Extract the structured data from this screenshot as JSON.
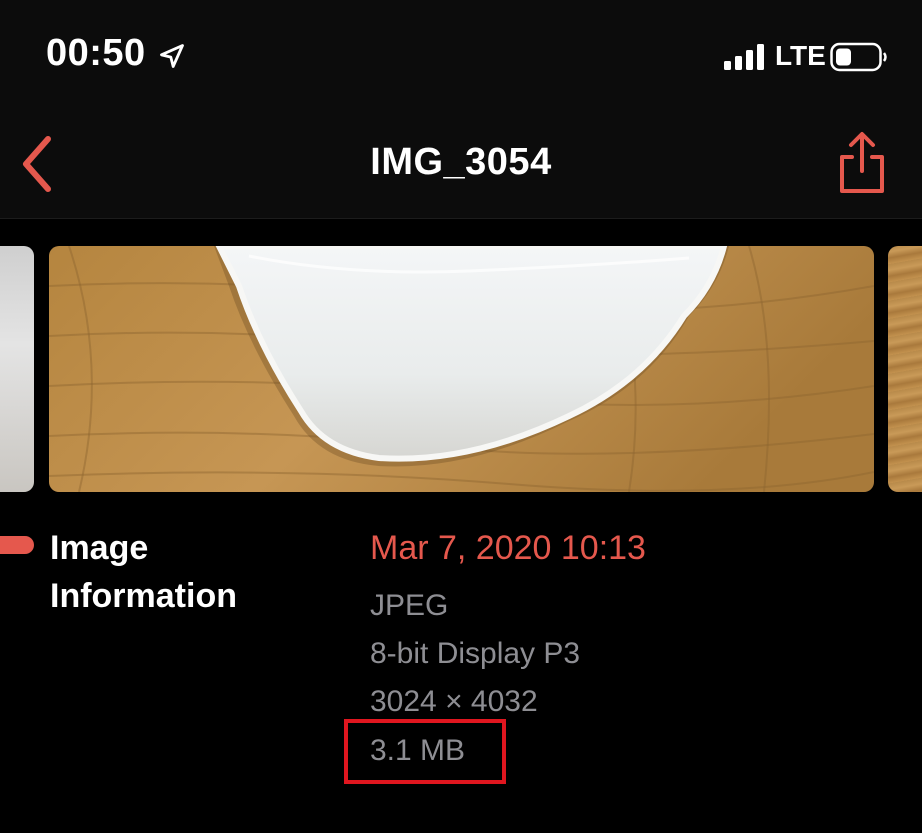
{
  "status_bar": {
    "time": "00:50",
    "network": "LTE",
    "icons": [
      "location-arrow-icon",
      "cellular-signal-icon",
      "battery-icon"
    ]
  },
  "nav": {
    "title": "IMG_3054",
    "back_icon": "chevron-left-icon",
    "share_icon": "share-icon"
  },
  "info": {
    "heading": "Image Information",
    "date": "Mar 7, 2020 10:13",
    "format": "JPEG",
    "color_profile": "8-bit Display P3",
    "dimensions": "3024 × 4032",
    "file_size": "3.1 MB"
  },
  "colors": {
    "accent": "#e5584d",
    "secondary_text": "#8e8e93",
    "highlight": "#e0161f",
    "background": "#000000"
  }
}
